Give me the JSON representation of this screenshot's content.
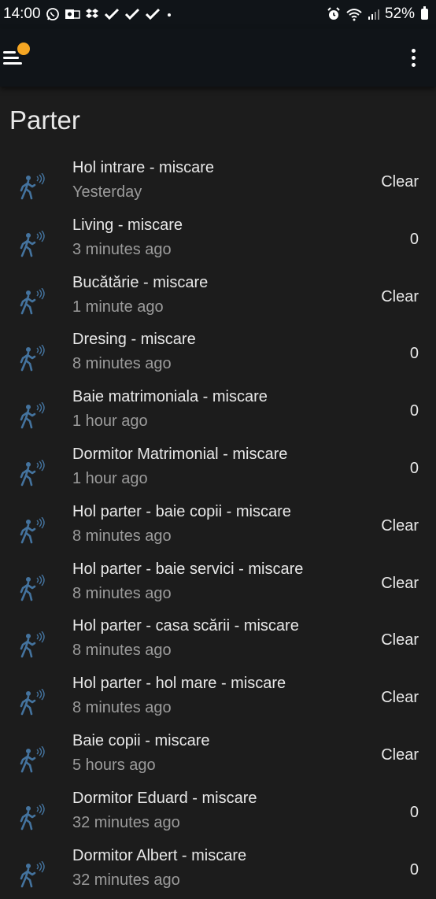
{
  "status_bar": {
    "time": "14:00",
    "left_icons": [
      "whatsapp-icon",
      "outlook-icon",
      "dropbox-icon",
      "check-icon",
      "check-icon",
      "check-icon",
      "dot-icon"
    ],
    "right_icons": [
      "alarm-icon",
      "wifi-icon",
      "signal-icon"
    ],
    "battery": "52%"
  },
  "app_bar": {
    "menu_icon": "hamburger-menu-icon",
    "notification_dot_color": "#f5a623",
    "more_icon": "more-vertical-icon"
  },
  "section": {
    "title": "Parter"
  },
  "colors": {
    "background": "#1c1c1c",
    "header": "#101418",
    "icon": "#44739e",
    "primary_text": "#e8e8e8",
    "secondary_text": "#9b9b9b"
  },
  "entities": [
    {
      "name": "Hol intrare - miscare",
      "last_changed": "Yesterday",
      "state": "Clear",
      "icon": "motion-sensor-icon"
    },
    {
      "name": "Living - miscare",
      "last_changed": "3 minutes ago",
      "state": "0",
      "icon": "motion-sensor-icon"
    },
    {
      "name": "Bucătărie - miscare",
      "last_changed": "1 minute ago",
      "state": "Clear",
      "icon": "motion-sensor-icon"
    },
    {
      "name": "Dresing - miscare",
      "last_changed": "8 minutes ago",
      "state": "0",
      "icon": "motion-sensor-icon"
    },
    {
      "name": "Baie matrimoniala - miscare",
      "last_changed": "1 hour ago",
      "state": "0",
      "icon": "motion-sensor-icon"
    },
    {
      "name": "Dormitor Matrimonial - miscare",
      "last_changed": "1 hour ago",
      "state": "0",
      "icon": "motion-sensor-icon"
    },
    {
      "name": "Hol parter - baie copii - miscare",
      "last_changed": "8 minutes ago",
      "state": "Clear",
      "icon": "motion-sensor-icon"
    },
    {
      "name": "Hol parter - baie servici - miscare",
      "last_changed": "8 minutes ago",
      "state": "Clear",
      "icon": "motion-sensor-icon"
    },
    {
      "name": "Hol parter - casa scării - miscare",
      "last_changed": "8 minutes ago",
      "state": "Clear",
      "icon": "motion-sensor-icon"
    },
    {
      "name": "Hol parter - hol mare - miscare",
      "last_changed": "8 minutes ago",
      "state": "Clear",
      "icon": "motion-sensor-icon"
    },
    {
      "name": "Baie copii - miscare",
      "last_changed": "5 hours ago",
      "state": "Clear",
      "icon": "motion-sensor-icon"
    },
    {
      "name": "Dormitor Eduard - miscare",
      "last_changed": "32 minutes ago",
      "state": "0",
      "icon": "motion-sensor-icon"
    },
    {
      "name": "Dormitor Albert - miscare",
      "last_changed": "32 minutes ago",
      "state": "0",
      "icon": "motion-sensor-icon"
    }
  ]
}
